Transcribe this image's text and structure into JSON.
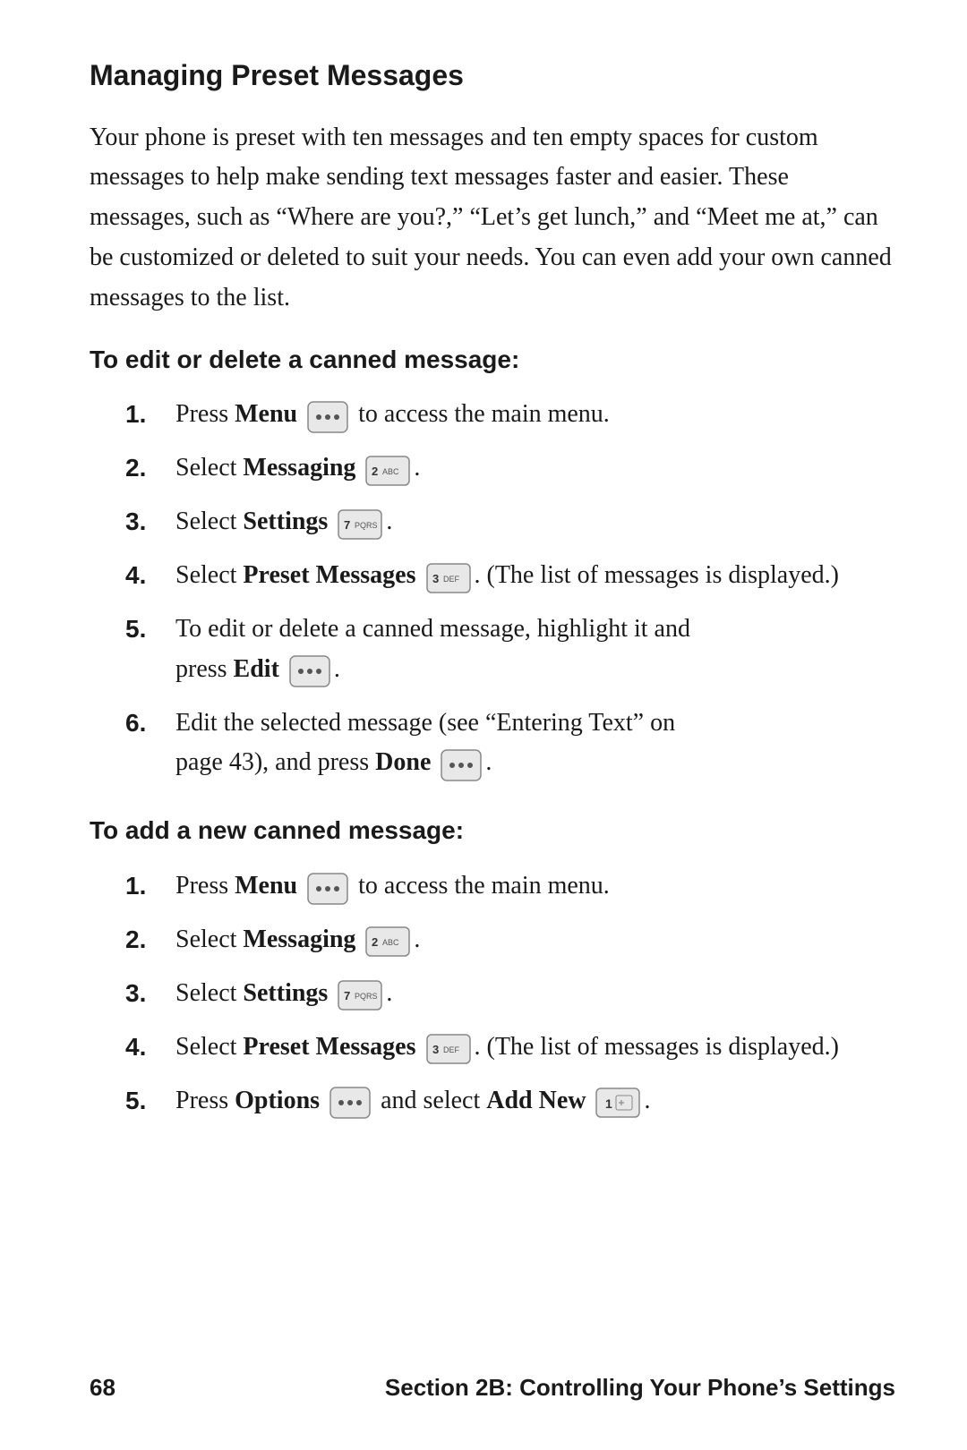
{
  "page": {
    "title": "Managing Preset Messages",
    "intro": "Your phone is preset with ten messages and ten empty spaces for custom messages to help make sending text messages faster and easier. These messages, such as “Where are you?,” “Let’s get lunch,” and “Meet me at,” can be customized or deleted to suit your needs. You can even add your own canned messages to the list.",
    "section1_heading": "To edit or delete a canned message:",
    "section1_steps": [
      {
        "number": "1.",
        "text": "Press ",
        "bold": "Menu",
        "suffix": " (···) to access the main menu."
      },
      {
        "number": "2.",
        "text": "Select ",
        "bold": "Messaging",
        "suffix": " (  2 ABC )."
      },
      {
        "number": "3.",
        "text": "Select ",
        "bold": "Settings",
        "suffix": " (  7 PQRS )."
      },
      {
        "number": "4.",
        "text": "Select ",
        "bold": "Preset Messages",
        "suffix": " (  3 DEF ). (The list of messages is displayed.)"
      },
      {
        "number": "5.",
        "text": "To edit or delete a canned message, highlight it and press ",
        "bold": "Edit",
        "suffix": " (···)."
      },
      {
        "number": "6.",
        "text": "Edit the selected message (see “Entering Text” on page 43), and press ",
        "bold": "Done",
        "suffix": " (···)."
      }
    ],
    "section2_heading": "To add a new canned message:",
    "section2_steps": [
      {
        "number": "1.",
        "text": "Press ",
        "bold": "Menu",
        "suffix": " (···) to access the main menu."
      },
      {
        "number": "2.",
        "text": "Select ",
        "bold": "Messaging",
        "suffix": " (  2 ABC )."
      },
      {
        "number": "3.",
        "text": "Select ",
        "bold": "Settings",
        "suffix": " (  7 PQRS )."
      },
      {
        "number": "4.",
        "text": "Select ",
        "bold": "Preset Messages",
        "suffix": " (  3 DEF ). (The list of messages is displayed.)"
      },
      {
        "number": "5.",
        "text": "Press ",
        "bold": "Options",
        "suffix": " (···) and select ",
        "bold2": "Add New",
        "suffix2": " (  1 )."
      }
    ],
    "footer": {
      "page_number": "68",
      "section": "Section 2B: Controlling Your Phone’s Settings"
    }
  }
}
